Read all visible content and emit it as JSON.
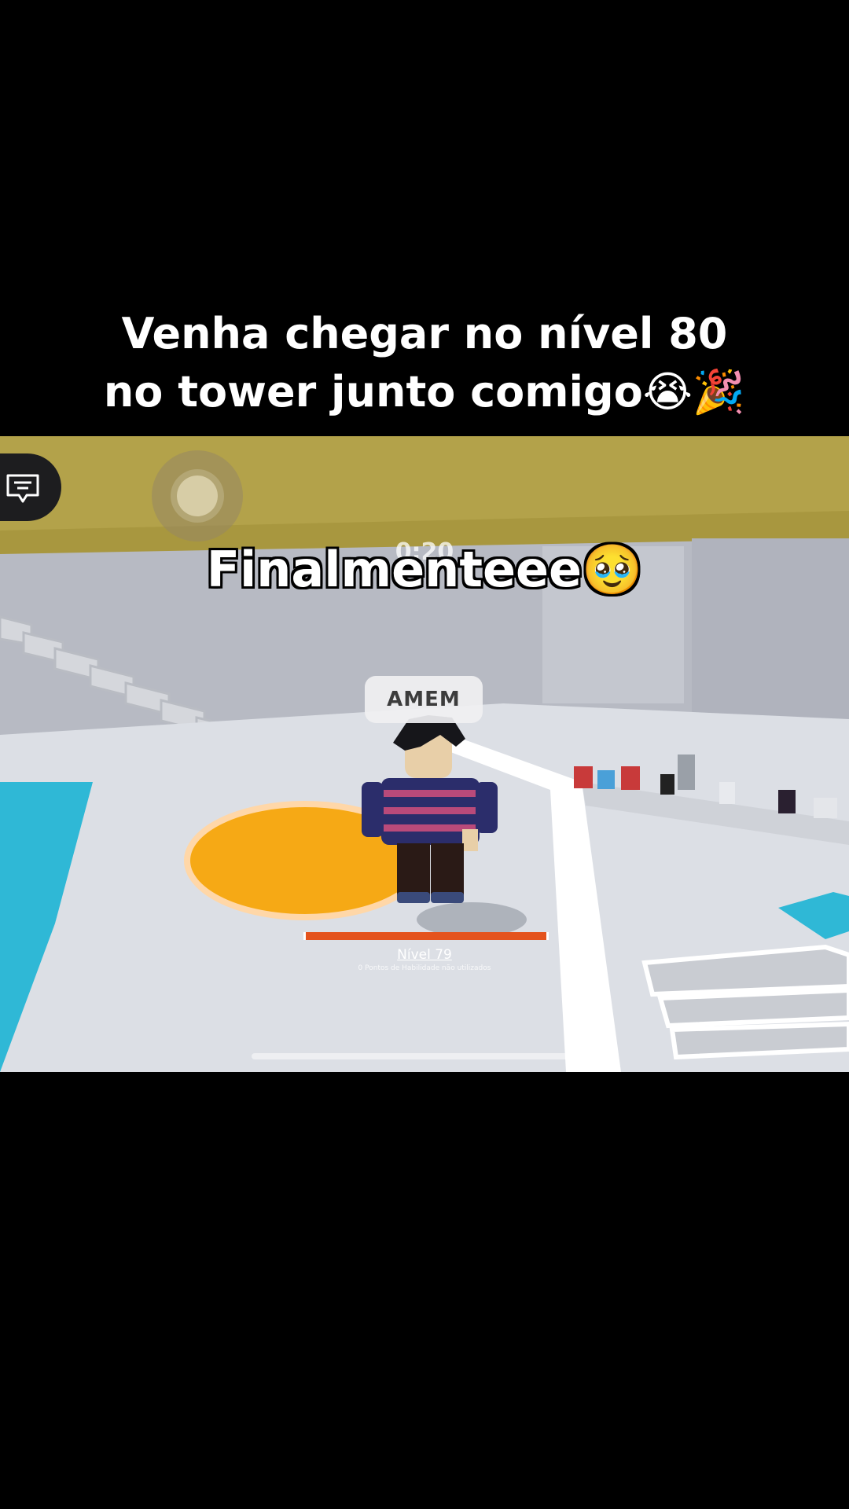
{
  "caption": {
    "line1": "Venha chegar no nível 80",
    "line2": "no tower junto comigo😭🎉"
  },
  "game": {
    "overlay_text": "Finalmenteee🥹",
    "timer": "0:20",
    "nametag": "AMEM",
    "xp_progress": 1.0,
    "level_label": "Nível 79",
    "skill_points": "0 Pontos de Habilidade não utilizados",
    "icons": {
      "chat": "chat-bubble-icon",
      "jump": "jump-joystick-icon"
    },
    "colors": {
      "ceiling": "#b3a24a",
      "floor": "#dcdfe5",
      "pool": "#2fb8d6",
      "glow_pad": "#f7a916",
      "xp_bar": "#e4531d"
    }
  }
}
